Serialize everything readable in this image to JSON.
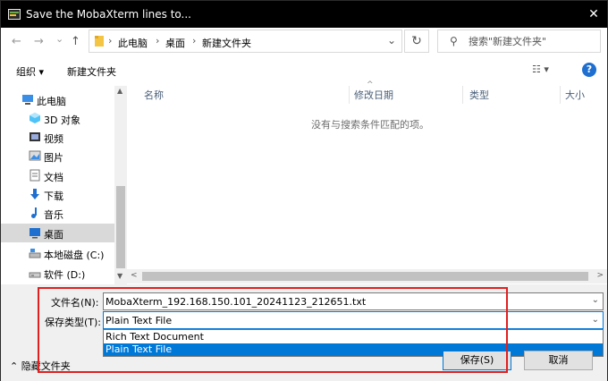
{
  "titlebar": {
    "title": "Save the MobaXterm lines to...",
    "close_label": "✕"
  },
  "nav_buttons": {
    "back": "←",
    "forward": "→",
    "history": "⌄",
    "up": "↑"
  },
  "address": {
    "crumbs": [
      "此电脑",
      "桌面",
      "新建文件夹"
    ],
    "separator": "›"
  },
  "search": {
    "placeholder": "搜索\"新建文件夹\""
  },
  "toolbar": {
    "organize": "组织 ▾",
    "new_folder": "新建文件夹"
  },
  "nav_pane": {
    "items": [
      {
        "label": "此电脑",
        "icon": "computer-icon"
      },
      {
        "label": "3D 对象",
        "icon": "3d-objects-icon"
      },
      {
        "label": "视频",
        "icon": "video-icon"
      },
      {
        "label": "图片",
        "icon": "pictures-icon"
      },
      {
        "label": "文档",
        "icon": "documents-icon"
      },
      {
        "label": "下载",
        "icon": "download-icon"
      },
      {
        "label": "音乐",
        "icon": "music-icon"
      },
      {
        "label": "桌面",
        "icon": "desktop-icon",
        "selected": true
      },
      {
        "label": "本地磁盘 (C:)",
        "icon": "local-disk-icon"
      },
      {
        "label": "软件 (D:)",
        "icon": "drive-icon"
      }
    ]
  },
  "file_list": {
    "columns": [
      "名称",
      "修改日期",
      "类型",
      "大小"
    ],
    "empty_message": "没有与搜索条件匹配的项。"
  },
  "form": {
    "filename_label": "文件名(N):",
    "filename_value": "MobaXterm_192.168.150.101_20241123_212651.txt",
    "filetype_label": "保存类型(T):",
    "filetype_value": "Plain Text File",
    "filetype_options": [
      "Rich Text Document",
      "Plain Text File"
    ],
    "filetype_selected_option": "Plain Text File"
  },
  "footer": {
    "hide_folders": "隐藏文件夹",
    "save": "保存(S)",
    "cancel": "取消"
  },
  "colors": {
    "accent": "#0078d7",
    "highlight_box": "#e02020",
    "titlebar": "#000000"
  }
}
